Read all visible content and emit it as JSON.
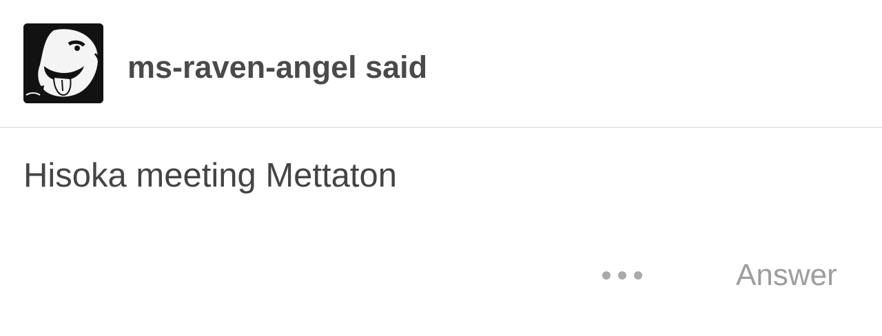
{
  "ask": {
    "asker": "ms-raven-angel said",
    "question": "Hisoka meeting Mettaton",
    "answer_label": "Answer"
  },
  "icons": {
    "avatar": "user-avatar",
    "more": "more-options-icon"
  },
  "colors": {
    "background": "#ffffff",
    "primary_text": "#444444",
    "muted_text": "#9d9d9d",
    "divider": "#e7e7e7"
  }
}
